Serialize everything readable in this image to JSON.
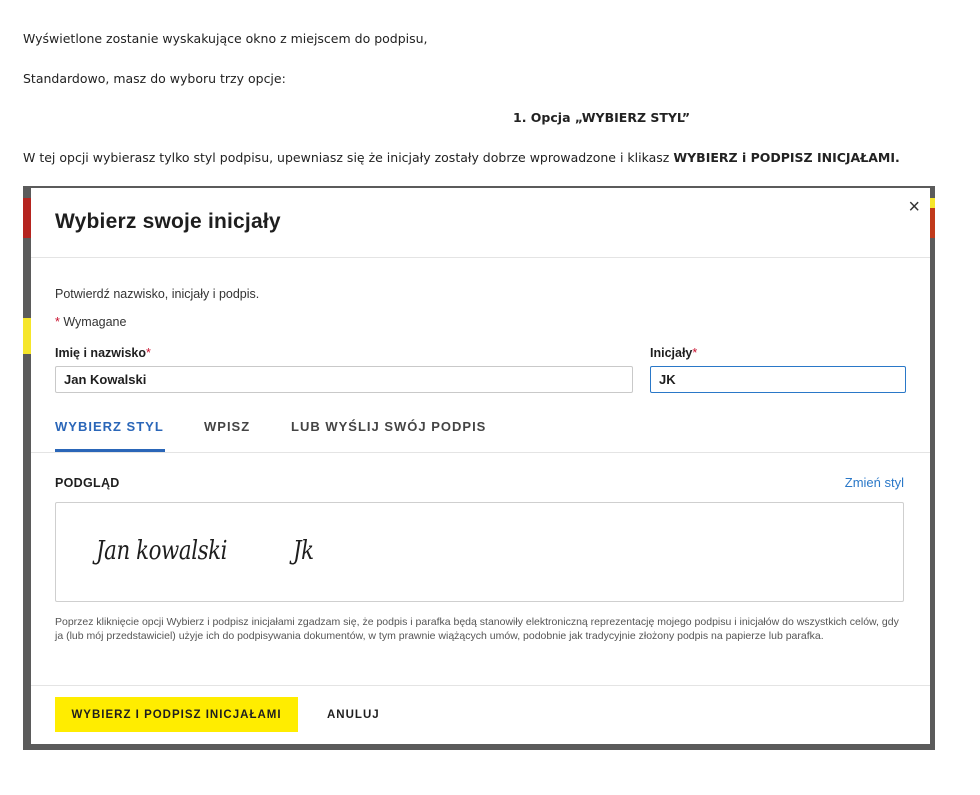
{
  "article": {
    "p1": "Wyświetlone  zostanie wyskakujące okno z miejscem do podpisu,",
    "p2": "Standardowo, masz do wyboru trzy opcje:",
    "heading": "1. Opcja „WYBIERZ STYL”",
    "p3_text": "W tej opcji wybierasz tylko styl podpisu, upewniasz się że inicjały zostały dobrze wprowadzone i klikasz ",
    "p3_bold": "WYBIERZ i PODPISZ INICJAŁAMI."
  },
  "modal": {
    "title": "Wybierz swoje inicjały",
    "close_icon": "×",
    "confirm_text": "Potwierdź nazwisko, inicjały i podpis.",
    "required_star": "*",
    "required_text": " Wymagane",
    "name_label": "Imię i nazwisko",
    "name_value": "Jan Kowalski",
    "initials_label": "Inicjały",
    "initials_value": "JK",
    "tabs": [
      {
        "label": "WYBIERZ STYL",
        "active": true
      },
      {
        "label": "WPISZ",
        "active": false
      },
      {
        "label": "LUB WYŚLIJ SWÓJ PODPIS",
        "active": false
      }
    ],
    "preview_label": "PODGLĄD",
    "change_style": "Zmień styl",
    "signature_name": "Jan kowalski",
    "signature_initials": "Jk",
    "legal": "Poprzez kliknięcie opcji Wybierz i podpisz inicjałami zgadzam się, że podpis i parafka będą stanowiły elektroniczną reprezentację mojego podpisu i inicjałów do wszystkich celów, gdy ja (lub mój przedstawiciel) użyje ich do podpisywania dokumentów, w tym prawnie wiążących umów, podobnie jak tradycyjnie złożony podpis na papierze lub parafka.",
    "primary_button": "WYBIERZ I PODPISZ INICJAŁAMI",
    "cancel_button": "ANULUJ"
  },
  "colors": {
    "accent": "#2a66b8",
    "primary_button": "#ffed00",
    "required": "#c8102e",
    "backdrop": "#5b5b5b"
  }
}
